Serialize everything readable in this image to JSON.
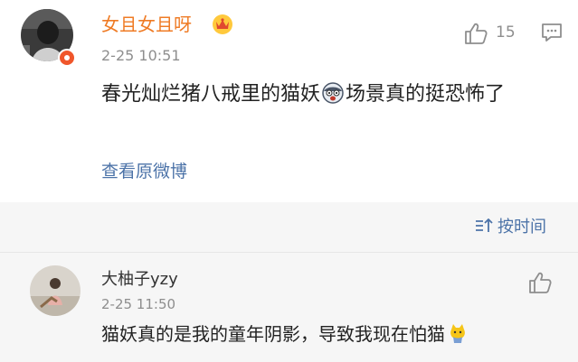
{
  "comment": {
    "username": "女且女且呀",
    "username_color": "#ef7b25",
    "badge_icon": "crown-badge-icon",
    "timestamp": "2-25 10:51",
    "like_count": "15",
    "text_before_emoji": "春光灿烂猪八戒里的猫妖",
    "emoji_icon": "scared-face-emoji-icon",
    "text_after_emoji": "场景真的挺恐怖了",
    "view_original_label": "查看原微博",
    "link_color": "#4c73a8"
  },
  "sort": {
    "label": "按时间",
    "icon": "sort-icon"
  },
  "reply": {
    "username": "大柚子yzy",
    "timestamp": "2-25 11:50",
    "text": "猫妖真的是我的童年阴影，导致我现在怕猫",
    "emoji_icon": "cat-emoji-icon"
  }
}
